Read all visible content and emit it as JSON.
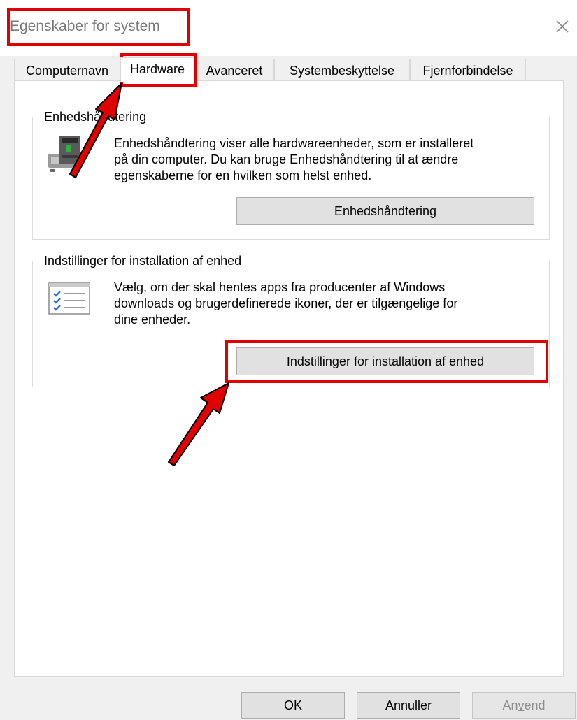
{
  "window": {
    "title": "Egenskaber for system",
    "close_icon": "close-icon"
  },
  "tabs": [
    {
      "label": "Computernavn",
      "active": false
    },
    {
      "label": "Hardware",
      "active": true
    },
    {
      "label": "Avanceret",
      "active": false
    },
    {
      "label": "Systembeskyttelse",
      "active": false
    },
    {
      "label": "Fjernforbindelse",
      "active": false
    }
  ],
  "device_manager": {
    "title": "Enhedshåndtering",
    "icon": "device-manager-icon",
    "lines": [
      "Enhedshåndtering viser alle hardwareenheder, som er installeret",
      "på din computer. Du kan bruge Enhedshåndtering til at ændre",
      "egenskaberne for en hvilken som helst enhed."
    ],
    "button_label": "Enhedshåndtering"
  },
  "install_settings": {
    "title": "Indstillinger for installation af enhed",
    "icon": "checklist-icon",
    "lines": [
      "Vælg, om der skal hentes apps fra producenter af Windows",
      "downloads og brugerdefinerede ikoner, der er tilgængelige for",
      "dine enheder."
    ],
    "button_label": "Indstillinger for installation af enhed"
  },
  "footer": {
    "ok_label": "OK",
    "cancel_label": "Annuller",
    "apply_label_pre": "An",
    "apply_label_mnemonic": "v",
    "apply_label_post": "end"
  },
  "colors": {
    "highlight": "#e00000",
    "arrow_fill": "#e00000",
    "arrow_outline": "#000000"
  }
}
